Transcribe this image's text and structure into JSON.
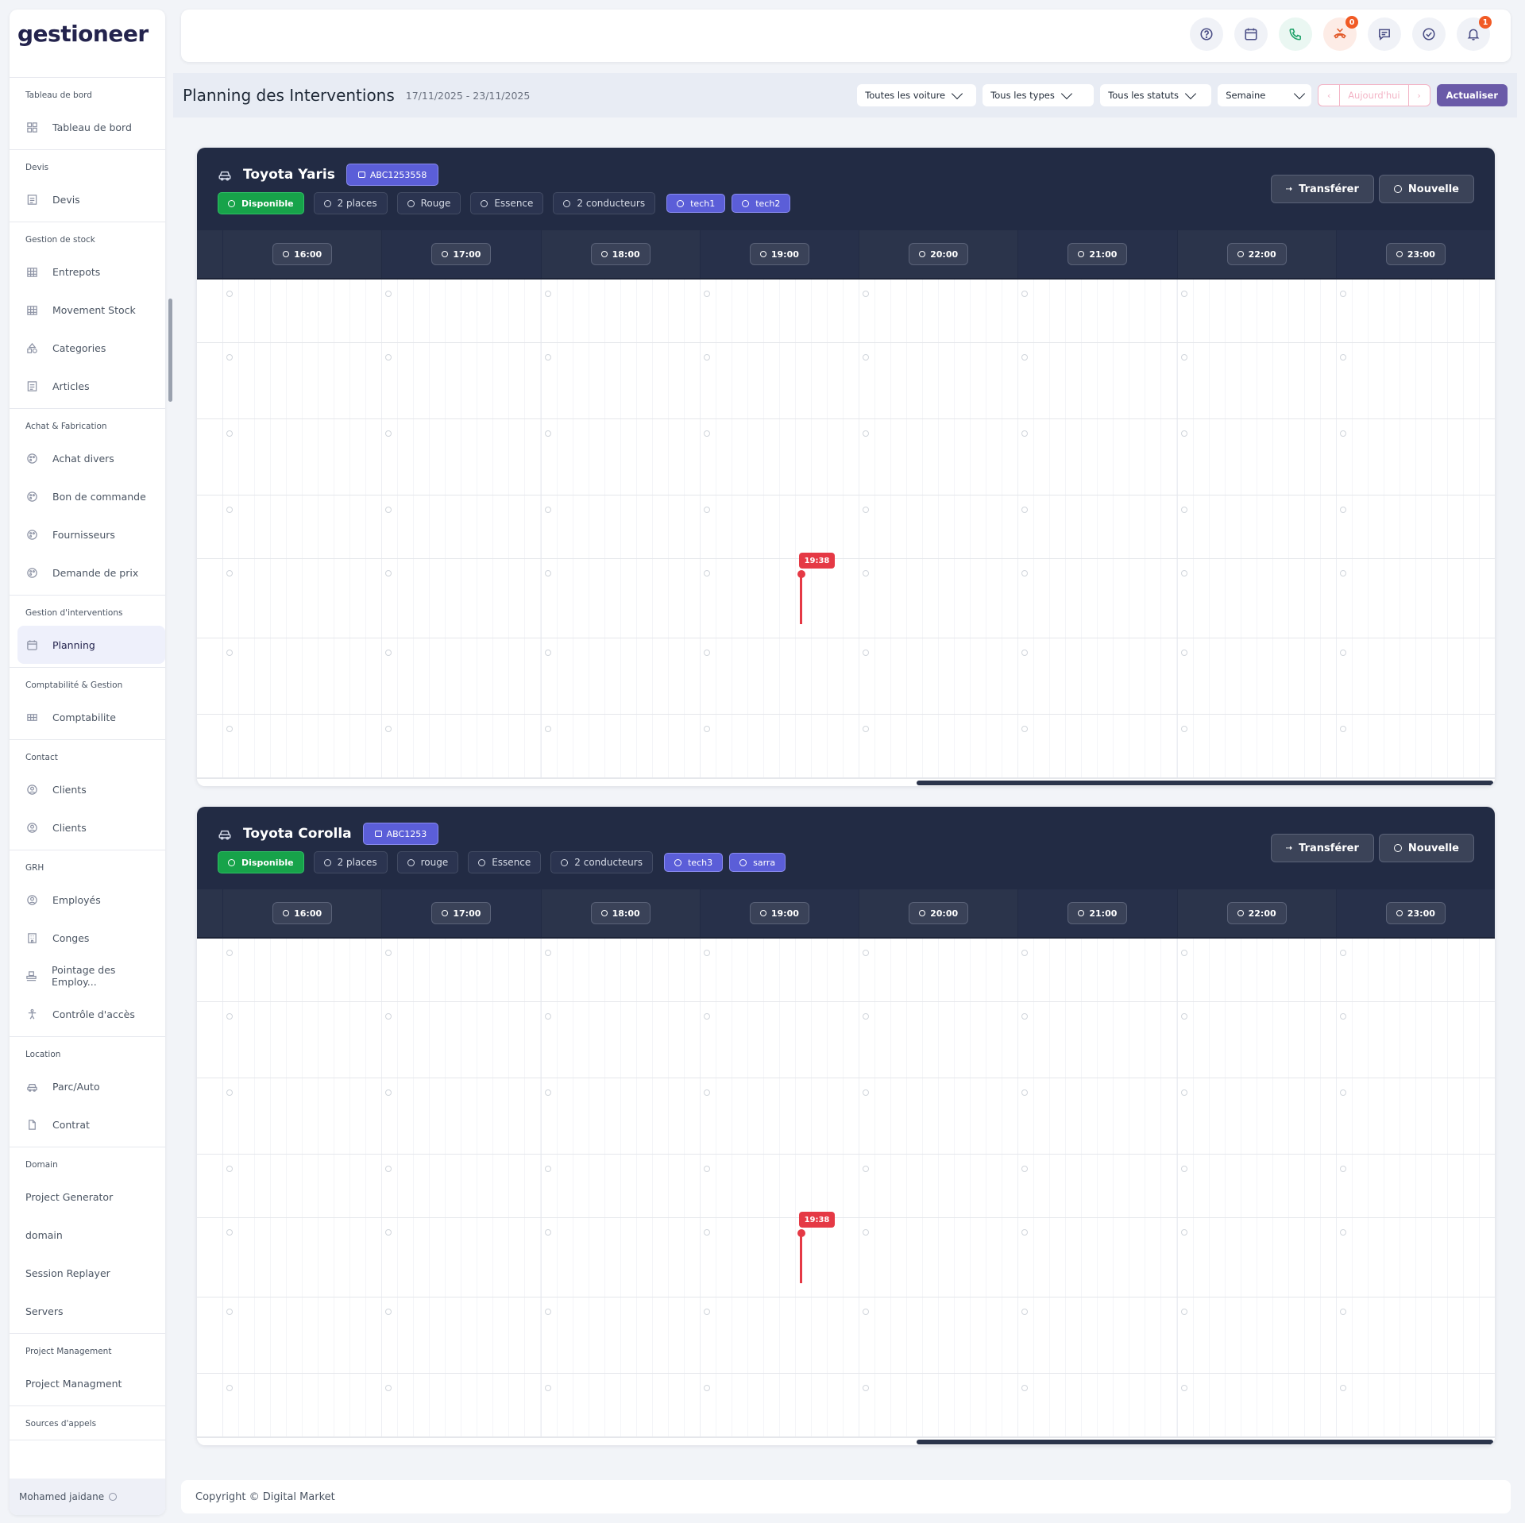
{
  "brand": "gestioneer",
  "sidebar": {
    "sections": [
      {
        "title": "Tableau de bord",
        "items": [
          {
            "label": "Tableau de bord",
            "icon": "dashboard-icon"
          }
        ]
      },
      {
        "title": "Devis",
        "items": [
          {
            "label": "Devis",
            "icon": "document-icon"
          }
        ]
      },
      {
        "title": "Gestion de stock",
        "items": [
          {
            "label": "Entrepots",
            "icon": "warehouse-icon"
          },
          {
            "label": "Movement Stock",
            "icon": "warehouse-icon"
          },
          {
            "label": "Categories",
            "icon": "shapes-icon"
          },
          {
            "label": "Articles",
            "icon": "document-icon"
          }
        ]
      },
      {
        "title": "Achat & Fabrication",
        "items": [
          {
            "label": "Achat divers",
            "icon": "palette-icon"
          },
          {
            "label": "Bon de commande",
            "icon": "palette-icon"
          },
          {
            "label": "Fournisseurs",
            "icon": "palette-icon"
          },
          {
            "label": "Demande de prix",
            "icon": "palette-icon"
          }
        ]
      },
      {
        "title": "Gestion d'interventions",
        "items": [
          {
            "label": "Planning",
            "icon": "calendar-icon",
            "active": true
          }
        ]
      },
      {
        "title": "Comptabilité & Gestion",
        "items": [
          {
            "label": "Comptabilite",
            "icon": "table-icon"
          }
        ]
      },
      {
        "title": "Contact",
        "items": [
          {
            "label": "Clients",
            "icon": "user-circle-icon"
          },
          {
            "label": "Clients",
            "icon": "user-circle-icon"
          }
        ]
      },
      {
        "title": "GRH",
        "items": [
          {
            "label": "Employés",
            "icon": "user-circle-icon"
          },
          {
            "label": "Conges",
            "icon": "building-icon"
          },
          {
            "label": "Pointage des Employ...",
            "icon": "stamp-icon"
          },
          {
            "label": "Contrôle d'accès",
            "icon": "accessibility-icon"
          }
        ]
      },
      {
        "title": "Location",
        "items": [
          {
            "label": "Parc/Auto",
            "icon": "car-icon"
          },
          {
            "label": "Contrat",
            "icon": "file-icon"
          }
        ]
      },
      {
        "title": "Domain",
        "items": [
          {
            "label": "Project Generator"
          },
          {
            "label": "domain"
          },
          {
            "label": "Session Replayer"
          },
          {
            "label": "Servers"
          }
        ]
      },
      {
        "title": "Project Management",
        "items": [
          {
            "label": "Project Managment"
          }
        ]
      },
      {
        "title": "Sources d'appels",
        "items": []
      }
    ],
    "user": "Mohamed jaidane"
  },
  "topbar": {
    "icons": [
      {
        "name": "help-icon",
        "variant": ""
      },
      {
        "name": "calendar-icon",
        "variant": ""
      },
      {
        "name": "phone-icon",
        "variant": "green"
      },
      {
        "name": "missed-call-icon",
        "variant": "orange",
        "badge": "0"
      },
      {
        "name": "chat-icon",
        "variant": ""
      },
      {
        "name": "check-circle-icon",
        "variant": ""
      },
      {
        "name": "bell-icon",
        "variant": "",
        "badge": "1"
      }
    ]
  },
  "header": {
    "title": "Planning des Interventions",
    "range": "17/11/2025 - 23/11/2025",
    "filter_vehicles": "Toutes les voiture",
    "filter_types": "Tous les types",
    "filter_status": "Tous les statuts",
    "view": "Semaine",
    "prev": "‹",
    "today": "Aujourd'hui",
    "next": "›",
    "refresh": "Actualiser"
  },
  "hours": [
    "16:00",
    "17:00",
    "18:00",
    "19:00",
    "20:00",
    "21:00",
    "22:00",
    "23:00"
  ],
  "now_label": "19:38",
  "vehicles": [
    {
      "name": "Toyota Yaris",
      "plate": "ABC1253558",
      "status": "Disponible",
      "seats": "2 places",
      "color": "Rouge",
      "fuel": "Essence",
      "drivers": "2 conducteurs",
      "techs": [
        "tech1",
        "tech2"
      ],
      "transfer": "Transférer",
      "new": "Nouvelle"
    },
    {
      "name": "Toyota Corolla",
      "plate": "ABC1253",
      "status": "Disponible",
      "seats": "2 places",
      "color": "rouge",
      "fuel": "Essence",
      "drivers": "2 conducteurs",
      "techs": [
        "tech3",
        "sarra"
      ],
      "transfer": "Transférer",
      "new": "Nouvelle"
    }
  ],
  "footer": "Copyright © Digital Market"
}
